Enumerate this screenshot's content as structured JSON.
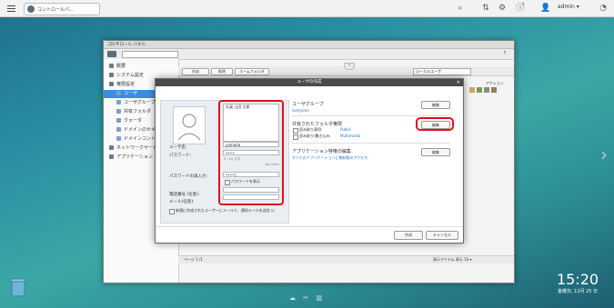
{
  "topbar": {
    "tab_title": "コントロールパ...",
    "user": "admin ▾",
    "notification_count": "3"
  },
  "window": {
    "title": "コントロール パネル",
    "controls": "_ □ ✕"
  },
  "sidebar": {
    "items": [
      {
        "label": "概要",
        "level": 0
      },
      {
        "label": "システム設定",
        "level": 0
      },
      {
        "label": "権限設定",
        "level": 0
      },
      {
        "label": "ユーザ",
        "level": 1,
        "active": true
      },
      {
        "label": "ユーザグループ",
        "level": 1
      },
      {
        "label": "共有フォルダ",
        "level": 1
      },
      {
        "label": "クォータ",
        "level": 1
      },
      {
        "label": "ドメインのセキュリティ",
        "level": 1
      },
      {
        "label": "ドメインコントローラ",
        "level": 1
      },
      {
        "label": "ネットワークサービス",
        "level": 0
      },
      {
        "label": "アプリケーション",
        "level": 0
      }
    ]
  },
  "main": {
    "toolbar": [
      "作成",
      "削除",
      "ホームフォルダ"
    ],
    "filter_value": "ローカルユーザ",
    "action_header": "アクション",
    "pager_text": "ページ 1 /1",
    "bottom_right": "表示アイテム  表示 10 ▾"
  },
  "dialog": {
    "title": "ユーザの作成",
    "close": "✕",
    "username_label": "ユーザ名:",
    "password_label": "パスワード:",
    "confirm_label": "パスワードの再入力:",
    "description_value": "社員 山田 太郎",
    "username_value": "yamada",
    "password_value": "••••",
    "password_hint": "0 - 64 文字",
    "password_strength": "Too short",
    "confirm_value": "••••|",
    "show_password": "パスワードを表示",
    "phone_label": "電話番号 (任意):",
    "email_label": "メール(任意):",
    "notify_text": "新規に作成されたユーザーにメールで、通知メールを送信 ☑",
    "group_section": "ユーザグループ",
    "group_value": "everyone",
    "share_section": "共有されたフォルダ権限",
    "share_readonly_label": "読み取り専用:",
    "share_readonly_value": "Public",
    "share_rw_label": "読み取り/書き込み:",
    "share_rw_value": "Multimedia",
    "app_section": "アプリケーション特権の編集",
    "app_value": "すべてのアプリケーションに無制限のアクセス",
    "edit_label": "編集",
    "create_button": "作成",
    "cancel_button": "キャンセル"
  },
  "desktop": {
    "time": "15:20",
    "date": "金曜日, 12月 25 日"
  },
  "colors": {
    "accent": "#3c8dde",
    "highlight_red": "#e0101b"
  }
}
